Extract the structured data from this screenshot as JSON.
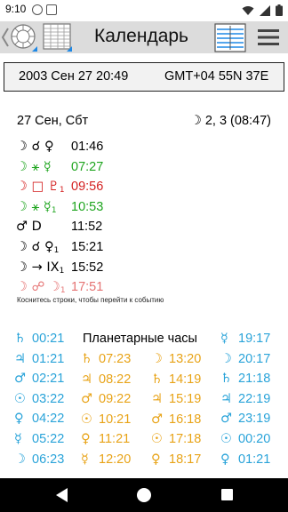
{
  "status_bar": {
    "time": "9:10"
  },
  "toolbar": {
    "title": "Календарь"
  },
  "date_box": {
    "datetime": "2003 Сен 27 20:49",
    "zone_coords": "GMT+04  55N 37E"
  },
  "day": {
    "header": "27 Сен, Сбт",
    "moon_phase": "☽ 2, 3 (08:47)"
  },
  "events": [
    {
      "glyph": "☽ ☌ ♀",
      "sub": "",
      "time": "01:46",
      "color": "#000000"
    },
    {
      "glyph": "☽ ⚹ ☿",
      "sub": "",
      "time": "07:27",
      "color": "#1fa51f"
    },
    {
      "glyph": "☽ □ ♇",
      "sub": "1",
      "time": "09:56",
      "color": "#d42020"
    },
    {
      "glyph": "☽ ⚹ ☿",
      "sub": "1",
      "time": "10:53",
      "color": "#1fa51f"
    },
    {
      "glyph": "♂ D",
      "sub": "",
      "time": "11:52",
      "color": "#000000"
    },
    {
      "glyph": "☽ ☌ ♀",
      "sub": "1",
      "time": "15:21",
      "color": "#000000"
    },
    {
      "glyph": "☽ → IX",
      "sub": "1",
      "time": "15:52",
      "color": "#000000"
    },
    {
      "glyph": "☽ ☍ ☽",
      "sub": "1",
      "time": "17:51",
      "color": "#e57373"
    }
  ],
  "hint": "Коснитесь строки, чтобы перейти к событию",
  "planetary_hours": {
    "title": "Планетарные часы",
    "day_column": [
      {
        "glyph": "♄",
        "time": "00:21",
        "color": "#29a3d9"
      },
      {
        "glyph": "♃",
        "time": "01:21",
        "color": "#29a3d9"
      },
      {
        "glyph": "♂",
        "time": "02:21",
        "color": "#29a3d9"
      },
      {
        "glyph": "☉",
        "time": "03:22",
        "color": "#29a3d9"
      },
      {
        "glyph": "♀",
        "time": "04:22",
        "color": "#29a3d9"
      },
      {
        "glyph": "☿",
        "time": "05:22",
        "color": "#29a3d9"
      },
      {
        "glyph": "☽",
        "time": "06:23",
        "color": "#29a3d9"
      }
    ],
    "col2": [
      {
        "glyph": "♄",
        "time": "07:23",
        "color": "#e8a317"
      },
      {
        "glyph": "♃",
        "time": "08:22",
        "color": "#e8a317"
      },
      {
        "glyph": "♂",
        "time": "09:22",
        "color": "#e8a317"
      },
      {
        "glyph": "☉",
        "time": "10:21",
        "color": "#e8a317"
      },
      {
        "glyph": "♀",
        "time": "11:21",
        "color": "#e8a317"
      },
      {
        "glyph": "☿",
        "time": "12:20",
        "color": "#e8a317"
      }
    ],
    "col3": [
      {
        "glyph": "☽",
        "time": "13:20",
        "color": "#e8a317"
      },
      {
        "glyph": "♄",
        "time": "14:19",
        "color": "#e8a317"
      },
      {
        "glyph": "♃",
        "time": "15:19",
        "color": "#e8a317"
      },
      {
        "glyph": "♂",
        "time": "16:18",
        "color": "#e8a317"
      },
      {
        "glyph": "☉",
        "time": "17:18",
        "color": "#e8a317"
      },
      {
        "glyph": "♀",
        "time": "18:17",
        "color": "#e8a317"
      }
    ],
    "col4": [
      {
        "glyph": "☿",
        "time": "19:17",
        "color": "#29a3d9"
      },
      {
        "glyph": "☽",
        "time": "20:17",
        "color": "#29a3d9"
      },
      {
        "glyph": "♄",
        "time": "21:18",
        "color": "#29a3d9"
      },
      {
        "glyph": "♃",
        "time": "22:19",
        "color": "#29a3d9"
      },
      {
        "glyph": "♂",
        "time": "23:19",
        "color": "#29a3d9"
      },
      {
        "glyph": "☉",
        "time": "00:20",
        "color": "#29a3d9"
      },
      {
        "glyph": "♀",
        "time": "01:21",
        "color": "#29a3d9"
      }
    ]
  }
}
